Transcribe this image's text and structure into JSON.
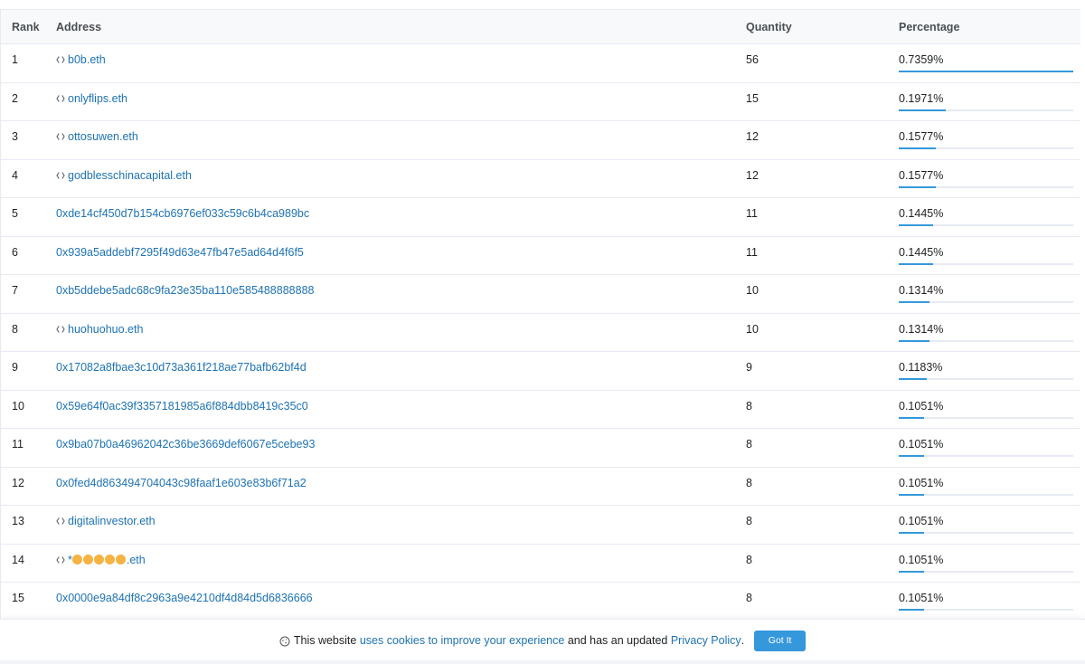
{
  "table": {
    "headers": {
      "rank": "Rank",
      "address": "Address",
      "quantity": "Quantity",
      "percentage": "Percentage"
    },
    "rows": [
      {
        "rank": "1",
        "address": "b0b.eth",
        "ens": true,
        "quantity": "56",
        "percentage": "0.7359%",
        "share": 0.7359
      },
      {
        "rank": "2",
        "address": "onlyflips.eth",
        "ens": true,
        "quantity": "15",
        "percentage": "0.1971%",
        "share": 0.1971
      },
      {
        "rank": "3",
        "address": "ottosuwen.eth",
        "ens": true,
        "quantity": "12",
        "percentage": "0.1577%",
        "share": 0.1577
      },
      {
        "rank": "4",
        "address": "godblesschinacapital.eth",
        "ens": true,
        "quantity": "12",
        "percentage": "0.1577%",
        "share": 0.1577
      },
      {
        "rank": "5",
        "address": "0xde14cf450d7b154cb6976ef033c59c6b4ca989bc",
        "ens": false,
        "quantity": "11",
        "percentage": "0.1445%",
        "share": 0.1445
      },
      {
        "rank": "6",
        "address": "0x939a5addebf7295f49d63e47fb47e5ad64d4f6f5",
        "ens": false,
        "quantity": "11",
        "percentage": "0.1445%",
        "share": 0.1445
      },
      {
        "rank": "7",
        "address": "0xb5ddebe5adc68c9fa23e35ba110e585488888888",
        "ens": false,
        "quantity": "10",
        "percentage": "0.1314%",
        "share": 0.1314
      },
      {
        "rank": "8",
        "address": "huohuohuo.eth",
        "ens": true,
        "quantity": "10",
        "percentage": "0.1314%",
        "share": 0.1314
      },
      {
        "rank": "9",
        "address": "0x17082a8fbae3c10d73a361f218ae77bafb62bf4d",
        "ens": false,
        "quantity": "9",
        "percentage": "0.1183%",
        "share": 0.1183
      },
      {
        "rank": "10",
        "address": "0x59e64f0ac39f3357181985a6f884dbb8419c35c0",
        "ens": false,
        "quantity": "8",
        "percentage": "0.1051%",
        "share": 0.1051
      },
      {
        "rank": "11",
        "address": "0x9ba07b0a46962042c36be3669def6067e5cebe93",
        "ens": false,
        "quantity": "8",
        "percentage": "0.1051%",
        "share": 0.1051
      },
      {
        "rank": "12",
        "address": "0x0fed4d863494704043c98faaf1e603e83b6f71a2",
        "ens": false,
        "quantity": "8",
        "percentage": "0.1051%",
        "share": 0.1051
      },
      {
        "rank": "13",
        "address": "digitalinvestor.eth",
        "ens": true,
        "quantity": "8",
        "percentage": "0.1051%",
        "share": 0.1051
      },
      {
        "rank": "14",
        "address": "*😶😶😶😶😶.eth",
        "ens": true,
        "emoji": true,
        "prefix": "*",
        "emoji_count": 5,
        "suffix": ".eth",
        "quantity": "8",
        "percentage": "0.1051%",
        "share": 0.1051
      },
      {
        "rank": "15",
        "address": "0x0000e9a84df8c2963a9e4210df4d84d5d6836666",
        "ens": false,
        "quantity": "8",
        "percentage": "0.1051%",
        "share": 0.1051
      }
    ]
  },
  "cookie_banner": {
    "text_before": "This website",
    "link1": "uses cookies to improve your experience",
    "text_middle": "and has an updated",
    "link2": "Privacy Policy",
    "text_after": ".",
    "button": "Got It"
  },
  "colors": {
    "link": "#1e73b5",
    "bar": "#3498db",
    "header_bg": "#f8f9fa",
    "border": "#e7eaf3"
  },
  "icons": {
    "ens": "ens-diamond-icon",
    "cookie": "cookie-icon"
  }
}
